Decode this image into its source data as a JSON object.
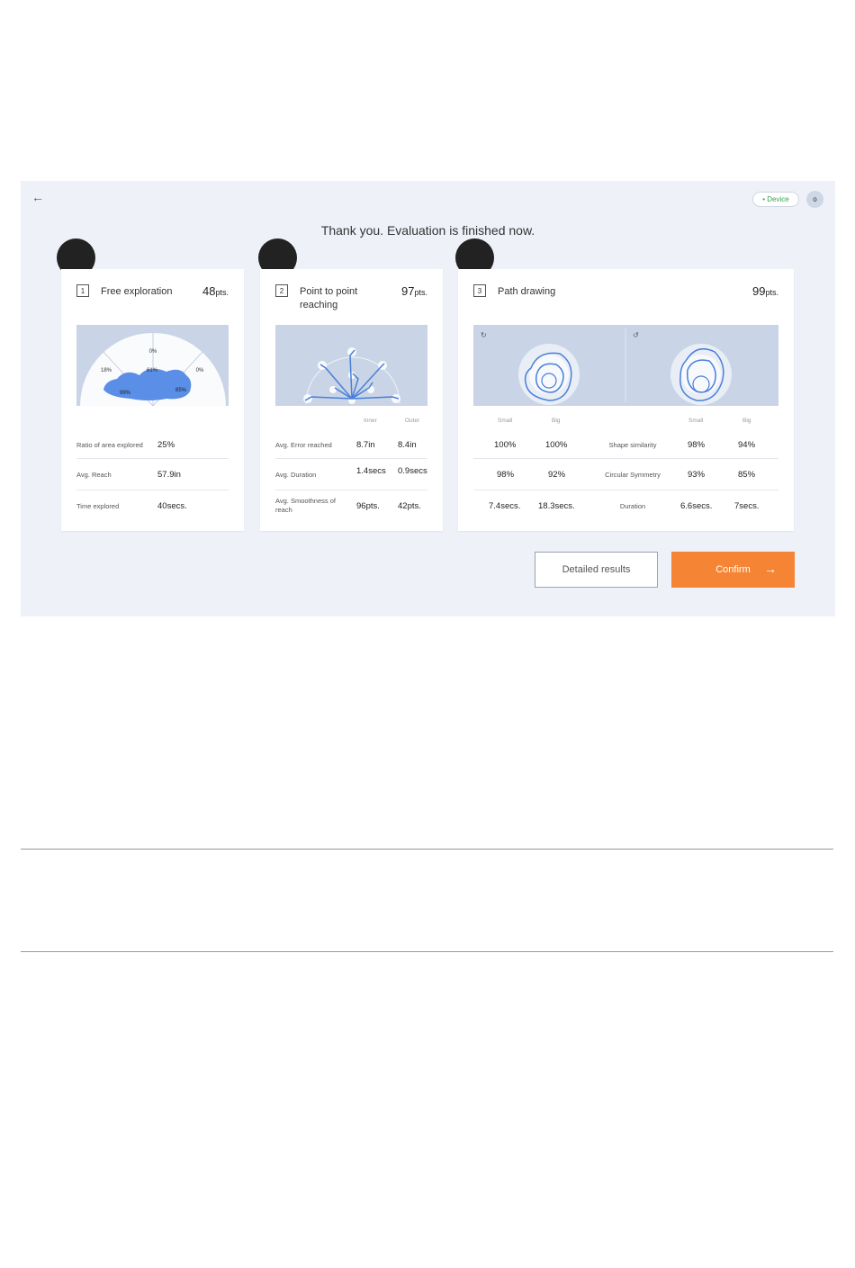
{
  "header": {
    "back_icon": "arrow-left-icon",
    "device_badge": "• Device",
    "avatar_initial": "o",
    "title": "Thank you. Evaluation is finished now."
  },
  "cards": [
    {
      "number": "1",
      "title": "Free exploration",
      "score": "48",
      "unit": "pts.",
      "sectors": [
        "0%",
        "18%",
        "61%",
        "0%",
        "99%",
        "85%"
      ],
      "stats": [
        {
          "label": "Ratio of area explored",
          "value": "25%"
        },
        {
          "label": "Avg. Reach",
          "value": "57.9in"
        },
        {
          "label": "Time explored",
          "value": "40secs."
        }
      ]
    },
    {
      "number": "2",
      "title": "Point to point reaching",
      "score": "97",
      "unit": "pts.",
      "col_headers": [
        "Inner",
        "Outer"
      ],
      "stats": [
        {
          "label": "Avg. Error reached",
          "inner": "8.7in",
          "outer": "8.4in"
        },
        {
          "label": "Avg. Duration",
          "inner": "1.4secs",
          "outer": "0.9secs"
        },
        {
          "label": "Avg. Smoothness of reach",
          "inner": "96pts.",
          "outer": "42pts."
        }
      ]
    },
    {
      "number": "3",
      "title": "Path drawing",
      "score": "99",
      "unit": "pts.",
      "col_headers": [
        "Small",
        "Big",
        "Small",
        "Big"
      ],
      "stats": [
        {
          "label": "Shape similarity",
          "left_small": "100%",
          "left_big": "100%",
          "right_small": "98%",
          "right_big": "94%"
        },
        {
          "label": "Circular Symmetry",
          "left_small": "98%",
          "left_big": "92%",
          "right_small": "93%",
          "right_big": "85%"
        },
        {
          "label": "Duration",
          "left_small": "7.4secs.",
          "left_big": "18.3secs.",
          "right_small": "6.6secs.",
          "right_big": "7secs."
        }
      ]
    }
  ],
  "buttons": {
    "detailed": "Detailed results",
    "confirm": "Confirm"
  },
  "colors": {
    "accent": "#f58534",
    "viz_bg": "#c9d5e6",
    "trace": "#4a7fd9",
    "app_bg": "#eef2f8"
  }
}
